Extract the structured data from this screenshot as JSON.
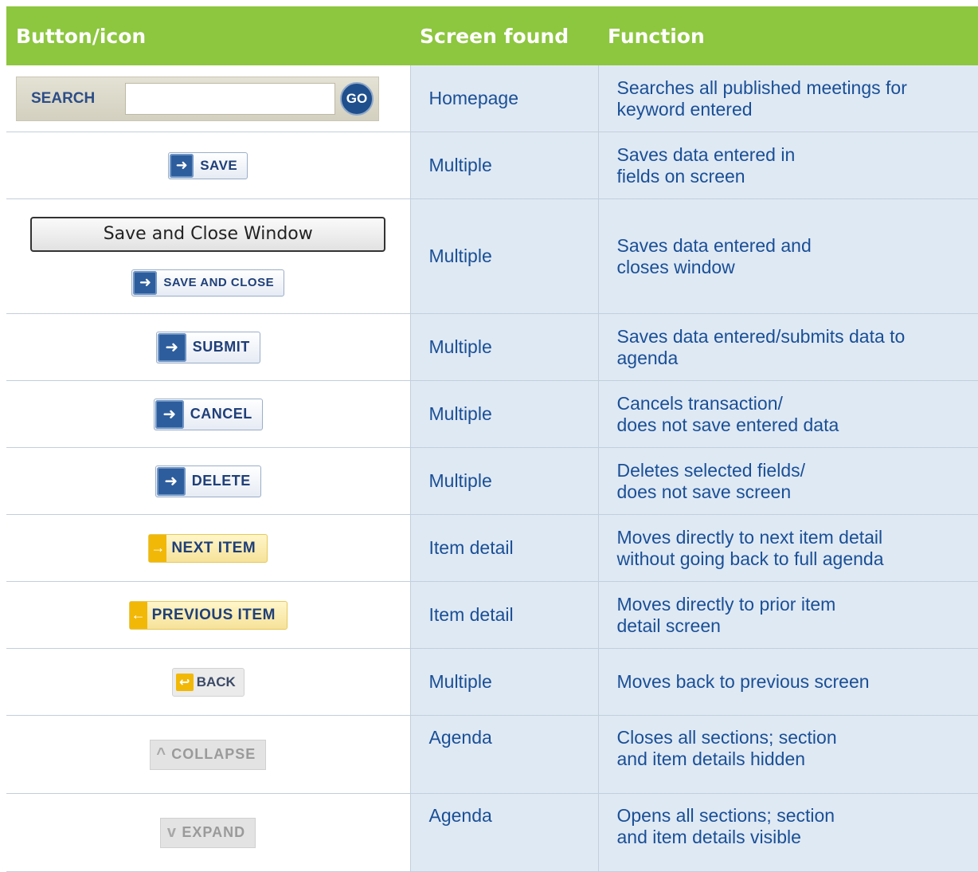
{
  "header": {
    "col1": "Button/icon",
    "col2": "Screen found",
    "col3": "Function"
  },
  "rows": [
    {
      "buttons": [
        "SEARCH",
        "GO"
      ],
      "screen": "Homepage",
      "function_lines": [
        "Searches all published meetings for",
        "keyword entered"
      ]
    },
    {
      "buttons": [
        "SAVE"
      ],
      "screen": "Multiple",
      "function_lines": [
        "Saves data entered in",
        "fields on screen"
      ]
    },
    {
      "buttons": [
        "Save and Close Window",
        "SAVE AND CLOSE"
      ],
      "screen": "Multiple",
      "function_lines": [
        "Saves data entered and",
        "closes window"
      ]
    },
    {
      "buttons": [
        "SUBMIT"
      ],
      "screen": "Multiple",
      "function_lines": [
        "Saves data entered/submits data to",
        "agenda"
      ]
    },
    {
      "buttons": [
        "CANCEL"
      ],
      "screen": "Multiple",
      "function_lines": [
        "Cancels transaction/",
        "does not save entered data"
      ]
    },
    {
      "buttons": [
        "DELETE"
      ],
      "screen": "Multiple",
      "function_lines": [
        "Deletes selected fields/",
        "does not save screen"
      ]
    },
    {
      "buttons": [
        "NEXT ITEM"
      ],
      "screen": "Item detail",
      "function_lines": [
        "Moves directly to next item detail",
        "without going back to full agenda"
      ]
    },
    {
      "buttons": [
        "PREVIOUS ITEM"
      ],
      "screen": "Item detail",
      "function_lines": [
        "Moves directly to prior item",
        "detail screen"
      ]
    },
    {
      "buttons": [
        "BACK"
      ],
      "screen": "Multiple",
      "function_lines": [
        "Moves back to previous screen"
      ]
    },
    {
      "buttons": [
        "COLLAPSE"
      ],
      "screen": "Agenda",
      "function_lines": [
        "Closes all sections; section",
        "and item details hidden"
      ]
    },
    {
      "buttons": [
        "EXPAND"
      ],
      "screen": "Agenda",
      "function_lines": [
        "Opens all sections; section",
        "and item details visible"
      ]
    }
  ],
  "colors": {
    "header_bg": "#8dc63f",
    "cell_bg": "#dfe9f4",
    "text_blue": "#1a4f95",
    "button_blue": "#2d5d9c",
    "button_yellow": "#f2b807"
  },
  "icons": {
    "blue_button": "arrow-right-box-icon",
    "next": "arrow-right-icon",
    "previous": "arrow-left-icon",
    "back": "back-arrow-icon",
    "collapse": "caret-up-icon",
    "expand": "caret-down-icon"
  }
}
